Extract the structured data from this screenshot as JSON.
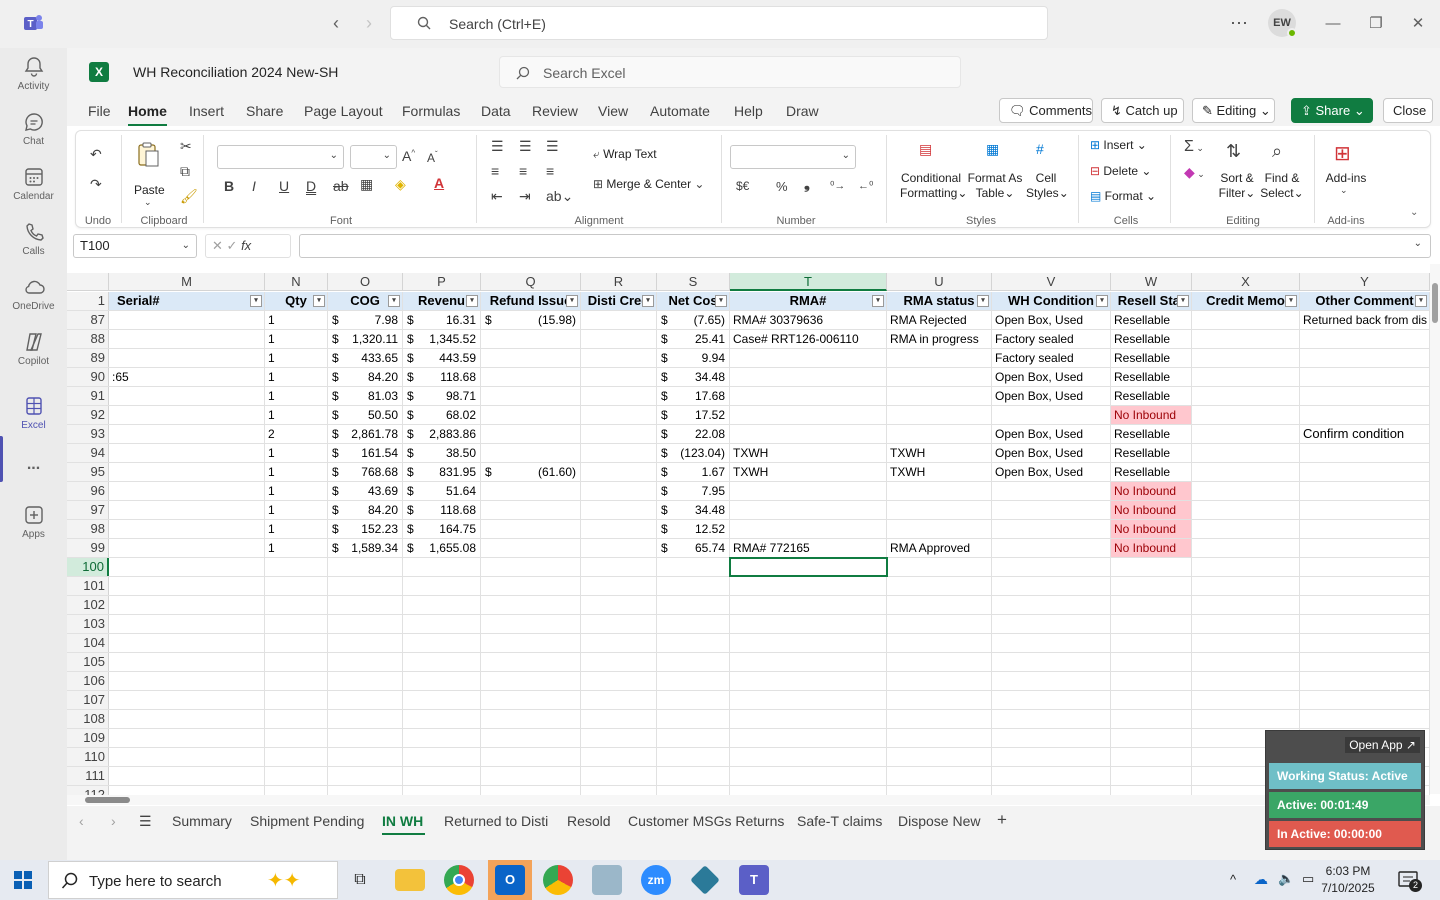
{
  "teams": {
    "search_placeholder": "Search (Ctrl+E)",
    "avatar_initials": "EW",
    "rail": [
      {
        "label": "Activity",
        "icon": "bell-icon"
      },
      {
        "label": "Chat",
        "icon": "chat-icon"
      },
      {
        "label": "Calendar",
        "icon": "calendar-icon"
      },
      {
        "label": "Calls",
        "icon": "phone-icon"
      },
      {
        "label": "OneDrive",
        "icon": "cloud-icon"
      },
      {
        "label": "Copilot",
        "icon": "copilot-icon"
      },
      {
        "label": "Excel",
        "icon": "excel-icon"
      },
      {
        "label": "...",
        "icon": "more-icon"
      },
      {
        "label": "Apps",
        "icon": "add-apps-icon"
      }
    ]
  },
  "excel": {
    "doc_title": "WH Reconciliation 2024 New-SH",
    "search_placeholder": "Search Excel",
    "menu": [
      "File",
      "Home",
      "Insert",
      "Share",
      "Page Layout",
      "Formulas",
      "Data",
      "Review",
      "View",
      "Automate",
      "Help",
      "Draw"
    ],
    "buttons": {
      "comments": "Comments",
      "catchup": "Catch up",
      "editing": "Editing",
      "share": "Share",
      "close": "Close"
    },
    "ribbon": {
      "undo_group": "Undo",
      "paste": "Paste",
      "clipboard_group": "Clipboard",
      "font_group": "Font",
      "wrap_text": "Wrap Text",
      "merge_center": "Merge & Center",
      "alignment_group": "Alignment",
      "number_group": "Number",
      "conditional_formatting_1": "Conditional",
      "conditional_formatting_2": "Formatting",
      "format_as_table_1": "Format As",
      "format_as_table_2": "Table",
      "cell_styles_1": "Cell",
      "cell_styles_2": "Styles",
      "styles_group": "Styles",
      "insert": "Insert",
      "delete": "Delete",
      "format": "Format",
      "cells_group": "Cells",
      "sort_filter_1": "Sort &",
      "sort_filter_2": "Filter",
      "find_select_1": "Find &",
      "find_select_2": "Select",
      "editing_group": "Editing",
      "addins": "Add-ins",
      "addins_group": "Add-ins",
      "sum_symbol": "Σ",
      "currency_symbol": "$€",
      "percent_symbol": "%",
      "comma_symbol": "❟"
    },
    "name_box": "T100",
    "fx": "fx",
    "columns": [
      "M",
      "N",
      "O",
      "P",
      "Q",
      "R",
      "S",
      "T",
      "U",
      "V",
      "W",
      "X",
      "Y"
    ],
    "headers": [
      "Serial#",
      "Qty",
      "COG",
      "Revenu",
      "Refund Issue",
      "Disti Cred",
      "Net Cos",
      "RMA#",
      "RMA status",
      "WH Condition",
      "Resell Stat",
      "Credit Memo",
      "Other Comment"
    ],
    "header_row_num": "1",
    "rows": [
      {
        "n": "87",
        "M": "",
        "N": "1",
        "O": "7.98",
        "P": "16.31",
        "Q": "(15.98)",
        "S": "(7.65)",
        "T": "RMA# 30379636",
        "U": "RMA Rejected",
        "V": "Open Box, Used",
        "W": "Resellable",
        "Y": "Returned back from dis"
      },
      {
        "n": "88",
        "M": "",
        "N": "1",
        "O": "1,320.11",
        "P": "1,345.52",
        "Q": "",
        "S": "25.41",
        "T": "Case# RRT126-006110",
        "U": "RMA in progress",
        "V": "Factory sealed",
        "W": "Resellable",
        "Y": ""
      },
      {
        "n": "89",
        "M": "",
        "N": "1",
        "O": "433.65",
        "P": "443.59",
        "Q": "",
        "S": "9.94",
        "T": "",
        "U": "",
        "V": "Factory sealed",
        "W": "Resellable",
        "Y": ""
      },
      {
        "n": "90",
        "M": ":65",
        "N": "1",
        "O": "84.20",
        "P": "118.68",
        "Q": "",
        "S": "34.48",
        "T": "",
        "U": "",
        "V": "Open Box, Used",
        "W": "Resellable",
        "Y": ""
      },
      {
        "n": "91",
        "M": "",
        "N": "1",
        "O": "81.03",
        "P": "98.71",
        "Q": "",
        "S": "17.68",
        "T": "",
        "U": "",
        "V": "Open Box, Used",
        "W": "Resellable",
        "Y": ""
      },
      {
        "n": "92",
        "M": "",
        "N": "1",
        "O": "50.50",
        "P": "68.02",
        "Q": "",
        "S": "17.52",
        "T": "",
        "U": "",
        "V": "",
        "W": "No Inbound",
        "Y": ""
      },
      {
        "n": "93",
        "M": "",
        "N": "2",
        "O": "2,861.78",
        "P": "2,883.86",
        "Q": "",
        "S": "22.08",
        "T": "",
        "U": "",
        "V": "Open Box, Used",
        "W": "Resellable",
        "Y": "Confirm condition"
      },
      {
        "n": "94",
        "M": "",
        "N": "1",
        "O": "161.54",
        "P": "38.50",
        "Q": "",
        "S": "(123.04)",
        "T": "TXWH",
        "U": "TXWH",
        "V": "Open Box, Used",
        "W": "Resellable",
        "Y": ""
      },
      {
        "n": "95",
        "M": "",
        "N": "1",
        "O": "768.68",
        "P": "831.95",
        "Q": "(61.60)",
        "S": "1.67",
        "T": "TXWH",
        "U": "TXWH",
        "V": "Open Box, Used",
        "W": "Resellable",
        "Y": ""
      },
      {
        "n": "96",
        "M": "",
        "N": "1",
        "O": "43.69",
        "P": "51.64",
        "Q": "",
        "S": "7.95",
        "T": "",
        "U": "",
        "V": "",
        "W": "No Inbound",
        "Y": ""
      },
      {
        "n": "97",
        "M": "",
        "N": "1",
        "O": "84.20",
        "P": "118.68",
        "Q": "",
        "S": "34.48",
        "T": "",
        "U": "",
        "V": "",
        "W": "No Inbound",
        "Y": ""
      },
      {
        "n": "98",
        "M": "",
        "N": "1",
        "O": "152.23",
        "P": "164.75",
        "Q": "",
        "S": "12.52",
        "T": "",
        "U": "",
        "V": "",
        "W": "No Inbound",
        "Y": ""
      },
      {
        "n": "99",
        "M": "",
        "N": "1",
        "O": "1,589.34",
        "P": "1,655.08",
        "Q": "",
        "S": "65.74",
        "T": "RMA# 772165",
        "U": "RMA Approved",
        "V": "",
        "W": "No Inbound",
        "Y": ""
      }
    ],
    "empty_rows": [
      "100",
      "101",
      "102",
      "103",
      "104",
      "105",
      "106",
      "107",
      "108",
      "109",
      "110",
      "111",
      "112"
    ],
    "currency": "$",
    "sheets": [
      "Summary",
      "Shipment Pending",
      "IN WH",
      "Returned to Disti",
      "Resold",
      "Customer MSGs Returns",
      "Safe-T claims",
      "Dispose New"
    ],
    "active_sheet": "IN WH"
  },
  "widget": {
    "open_app": "Open App ↗",
    "status": "Working Status: Active",
    "active": "Active: 00:01:49",
    "inactive": "In Active: 00:00:00",
    "colors": {
      "status": "#6fbfc7",
      "active": "#3aa666",
      "inactive": "#e05a4f"
    }
  },
  "taskbar": {
    "search_placeholder": "Type here to search",
    "time": "6:03 PM",
    "date": "7/10/2025",
    "notifications": "2"
  },
  "colors": {
    "excel_green": "#107c41",
    "teams_purple": "#4f52b2",
    "no_inbound_fill": "#ffc7ce",
    "no_inbound_text": "#9c0006",
    "header_fill": "#dbe9f7"
  }
}
